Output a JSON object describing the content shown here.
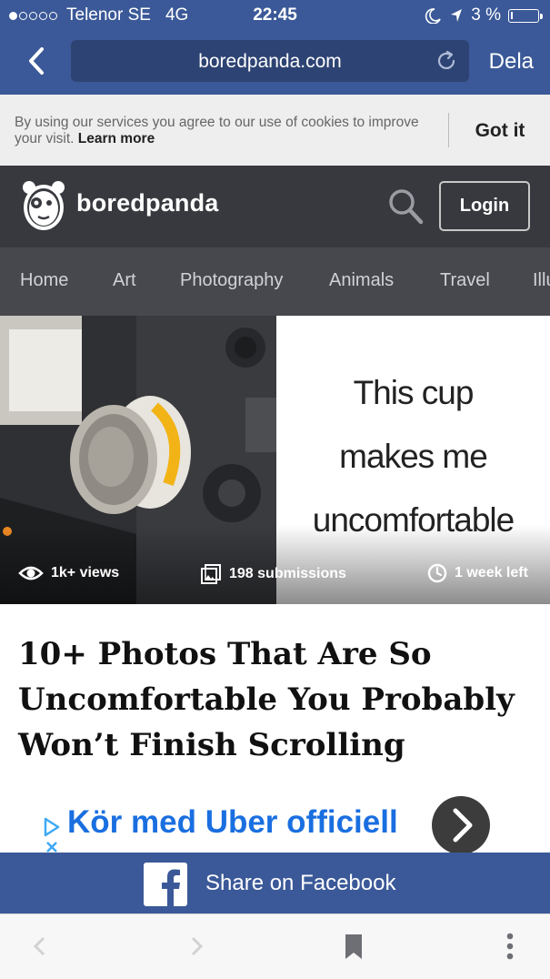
{
  "status_bar": {
    "carrier": "Telenor SE",
    "network": "4G",
    "time": "22:45",
    "battery": "3 %",
    "battery_level": 0.03,
    "signal_bars_filled": 1,
    "signal_bars_total": 5
  },
  "browser": {
    "url": "boredpanda.com",
    "share_label": "Dela"
  },
  "cookie_banner": {
    "text": "By using our services you agree to our use of cookies to improve your visit.",
    "learn_more": "Learn more",
    "accept": "Got it"
  },
  "site": {
    "brand": "boredpanda",
    "login": "Login",
    "nav": [
      "Home",
      "Art",
      "Photography",
      "Animals",
      "Travel",
      "Illu"
    ]
  },
  "hero": {
    "caption_lines": [
      "This cup",
      "makes me",
      "uncomfortable"
    ],
    "views": "1k+ views",
    "submissions": "198 submissions",
    "time_left": "1 week left"
  },
  "article": {
    "title": "10+ Photos That Are So Uncomfortable You Probably Won’t Finish Scrolling"
  },
  "ad": {
    "text": "Kör med Uber officiell"
  },
  "share_bar": {
    "label": "Share on Facebook"
  },
  "colors": {
    "facebook_blue": "#3b5998",
    "header_dark": "#37393e",
    "nav_dark": "#46484e",
    "ad_blue": "#1a6fe0"
  },
  "icons": [
    "back-chevron-icon",
    "reload-icon",
    "panda-logo-icon",
    "search-icon",
    "eye-icon",
    "gallery-icon",
    "clock-icon",
    "ad-choices-icon",
    "chevron-right-icon",
    "facebook-icon",
    "back-arrow-icon",
    "forward-arrow-icon",
    "bookmark-icon",
    "more-icon"
  ]
}
